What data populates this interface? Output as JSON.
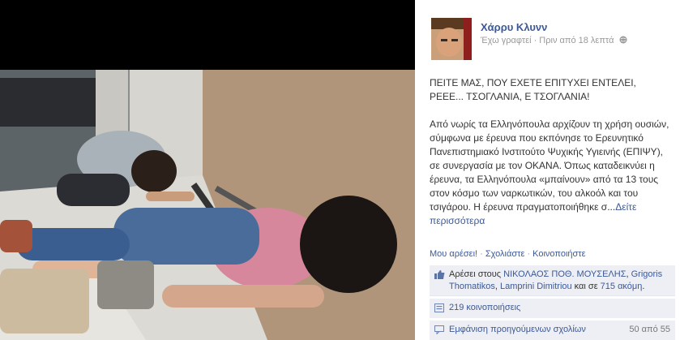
{
  "photo": {
    "alt": "news-photo"
  },
  "post": {
    "author": "Χάρρυ Κλυνν",
    "meta": "Έχω γραφτεί · Πριν από 18 λεπτά",
    "headline": "ΠΕΙΤΕ ΜΑΣ, ΠΟΥ ΕΧΕΤΕ ΕΠΙΤΥΧΕΙ ΕΝΤΕΛΕΙ, ΡΕΕΕ... ΤΣΟΓΛΑΝΙΑ, Ε ΤΣΟΓΛΑΝΙΑ!",
    "body": "Από νωρίς τα Ελληνόπουλα αρχίζουν τη χρήση ουσιών, σύμφωνα με έρευνα που εκπόνησε το Ερευνητικό Πανεπιστημιακό Ινστιτούτο Ψυχικής Υγιεινής (ΕΠΙΨΥ), σε συνεργασία με τον ΟΚΑΝΑ. Όπως καταδεικνύει η έρευνα, τα Ελληνόπουλα «μπαίνουν» από τα 13 τους στον κόσμο των ναρκωτικών, του αλκοόλ και του τσιγάρου. Η έρευνα πραγματοποιήθηκε σ...",
    "see_more": "Δείτε περισσότερα"
  },
  "actions": {
    "like": "Μου αρέσει!",
    "sep": " · ",
    "comment": "Σχολιάστε",
    "share": "Κοινοποιήστε"
  },
  "likes": {
    "prefix": "Αρέσει στους ",
    "names": "ΝΙΚΟΛΑΟΣ ΠΟΘ. ΜΟΥΣΕΛΗΣ",
    "comma": ", ",
    "name2": "Grigoris Thomatikos",
    "comma2": ", ",
    "name3": "Lamprini Dimitriou",
    "and": " και σε ",
    "others": "715 ακόμη",
    "dot": "."
  },
  "shares": {
    "label": "219 κοινοποιήσεις"
  },
  "comments": {
    "prev_label": "Εμφάνιση προηγούμενων σχολίων",
    "count": "50 από 55"
  },
  "colors": {
    "link": "#3b5998",
    "panel": "#edeff4",
    "meta": "#999999"
  }
}
